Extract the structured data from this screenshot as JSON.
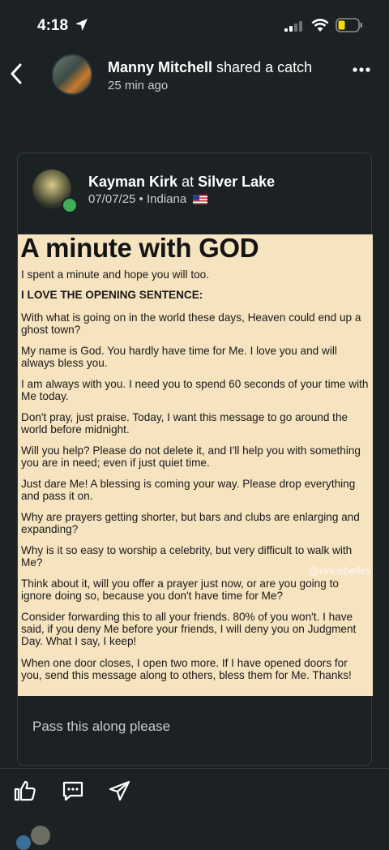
{
  "status_bar": {
    "time": "4:18"
  },
  "header": {
    "user_name": "Manny Mitchell",
    "action_text": "shared a catch",
    "time_ago": "25 min ago"
  },
  "post": {
    "user_name": "Kayman Kirk",
    "at_text": "at",
    "location": "Silver Lake",
    "meta": "07/07/25 • Indiana"
  },
  "image_text": {
    "title": "A minute with GOD",
    "lines": [
      "I spent a minute and hope you will too.",
      "I LOVE THE OPENING SENTENCE:",
      "With what is going on in the world these days, Heaven could end up a ghost town?",
      "My name is God.  You hardly have time for Me.  I love you and will always bless you.",
      "I am always with you.  I need you to spend 60 seconds of your time with Me today.",
      "Don't pray, just praise.  Today, I want this message to go around the world before midnight.",
      "Will you help?  Please do not delete it, and I'll help you with something you are in need; even if just quiet time.",
      "Just dare Me!  A blessing is coming your way.  Please drop everything and pass it on.",
      "Why are prayers getting shorter, but bars and clubs are enlarging and expanding?",
      "Why is it so easy to worship a celebrity, but very difficult to walk with Me?",
      "Think about it, will you offer a prayer just now, or are you going to ignore doing so, because you don't have time for Me?",
      "Consider forwarding  this to all your friends.  80% of you won't.  I have said, if you deny Me before your friends, I will deny you on Judgment Day.  What I say, I keep!",
      "When one door closes, I open two more.  If I have opened doors for you, send this message along to others, bless them for Me.  Thanks!"
    ],
    "watermark": "@vincebelles"
  },
  "caption": "Pass this along please",
  "actions": {
    "like_icon": "thumbs-up-icon",
    "comment_icon": "comment-icon",
    "share_icon": "send-icon"
  },
  "colors": {
    "background": "#1c2224",
    "image_bg": "#f6e3bf",
    "badge": "#3cae5a"
  }
}
